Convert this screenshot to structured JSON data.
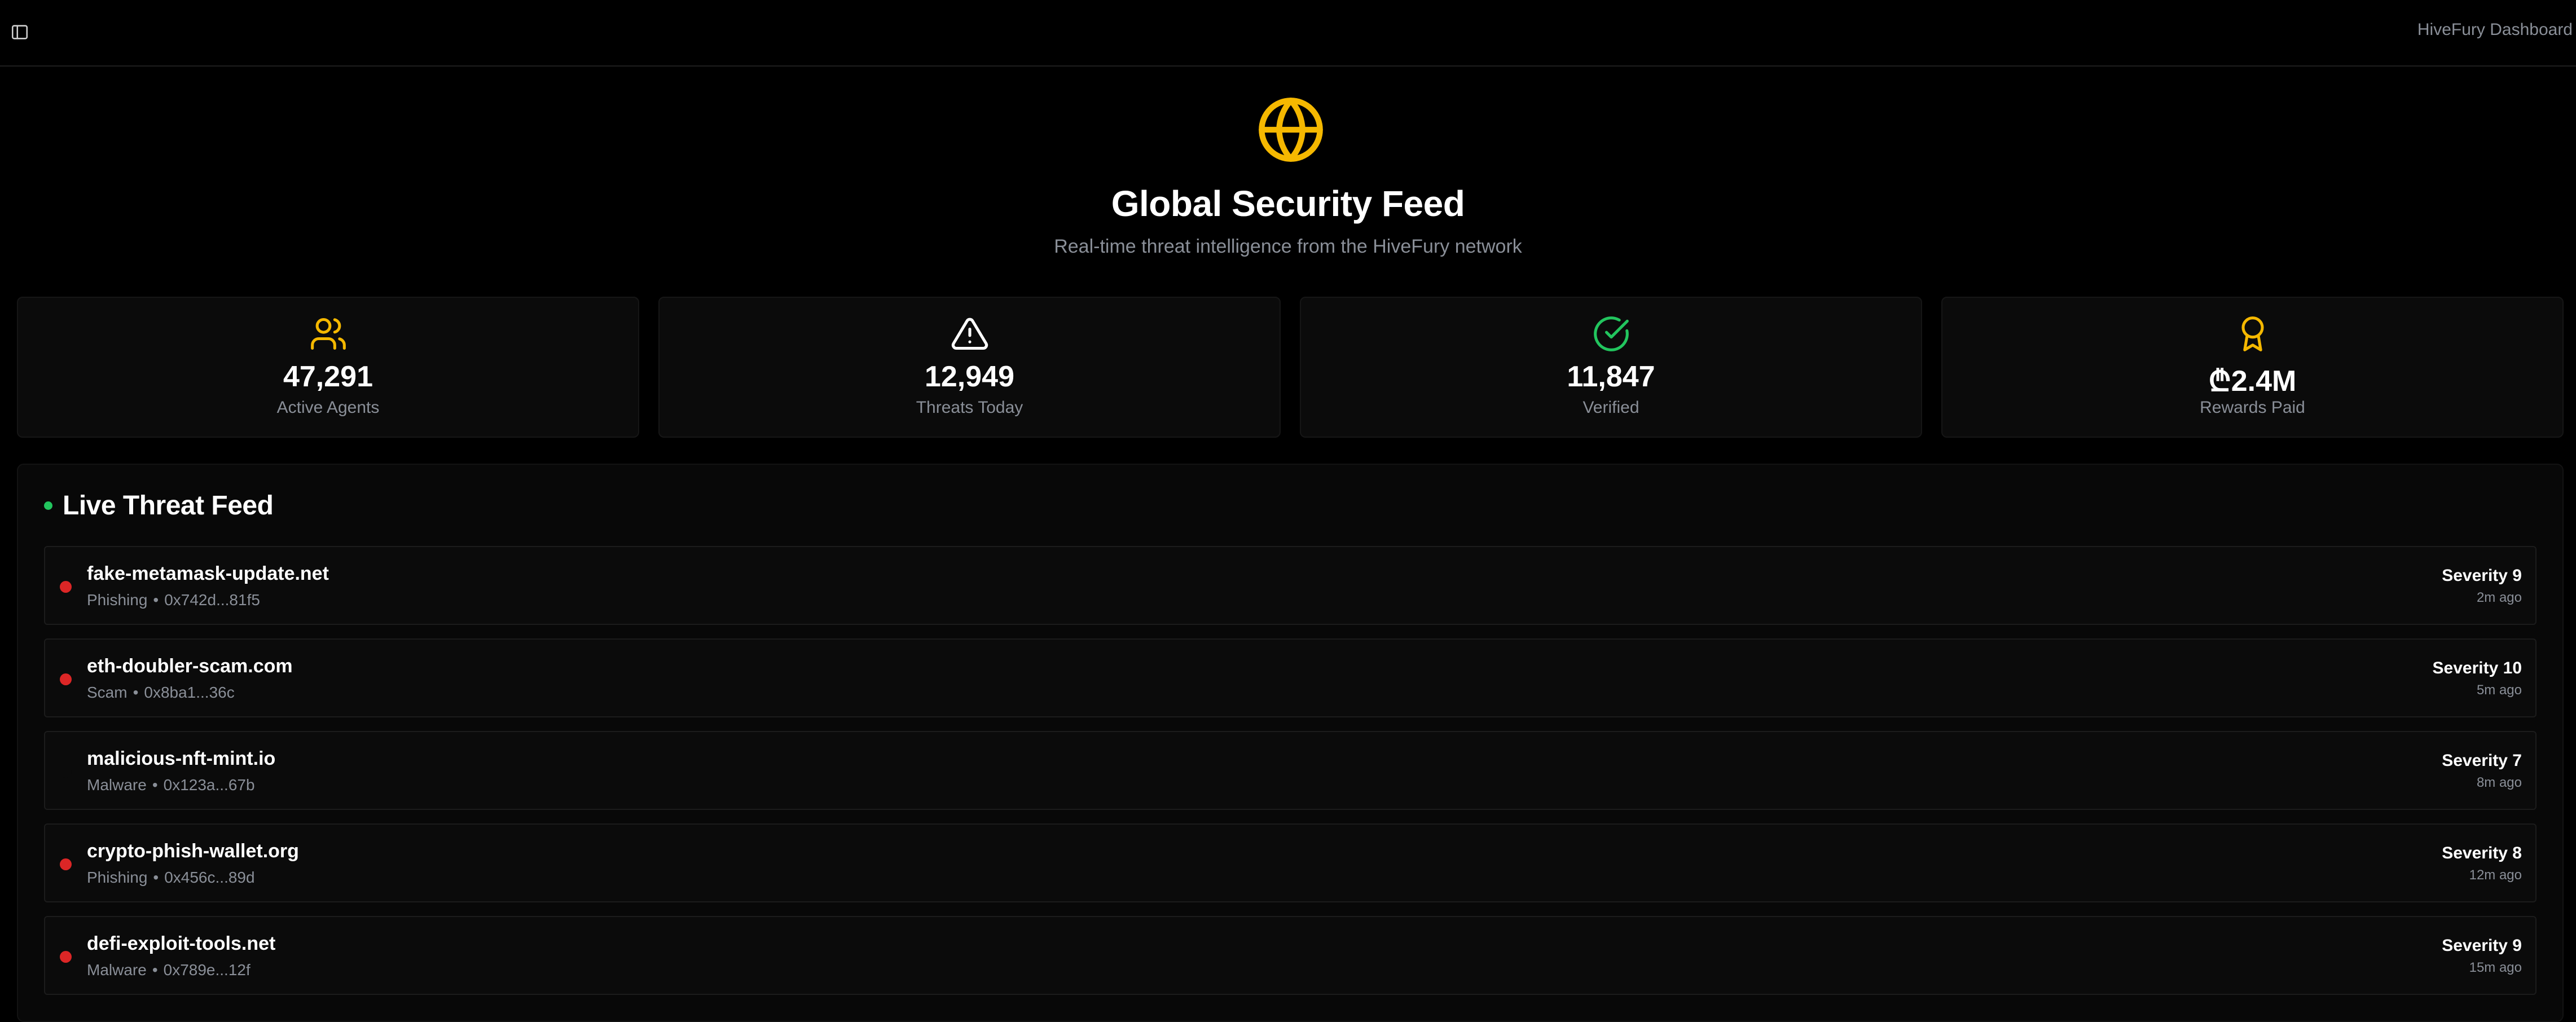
{
  "header": {
    "app_title": "HiveFury Dashboard",
    "sidebar_toggle_icon": "sidebar-toggle-icon"
  },
  "hero": {
    "icon": "globe-icon",
    "title": "Global Security Feed",
    "subtitle": "Real-time threat intelligence from the HiveFury network"
  },
  "colors": {
    "accent": "#f5b800",
    "success": "#22c55e",
    "danger": "#dc2626",
    "muted_text": "#8a8f98"
  },
  "stats": [
    {
      "icon": "users-icon",
      "value": "47,291",
      "label": "Active Agents"
    },
    {
      "icon": "alert-triangle-icon",
      "value": "12,949",
      "label": "Threats Today"
    },
    {
      "icon": "check-circle-icon",
      "value": "11,847",
      "label": "Verified"
    },
    {
      "icon": "award-icon",
      "value": "₾2.4M",
      "label": "Rewards Paid"
    }
  ],
  "feed": {
    "title": "Live Threat Feed",
    "items": [
      {
        "domain": "fake-metamask-update.net",
        "category": "Phishing",
        "address": "0x742d...81f5",
        "severity": "Severity 9",
        "time": "2m ago",
        "dot_color": "#dc2626"
      },
      {
        "domain": "eth-doubler-scam.com",
        "category": "Scam",
        "address": "0x8ba1...36c",
        "severity": "Severity 10",
        "time": "5m ago",
        "dot_color": "#dc2626"
      },
      {
        "domain": "malicious-nft-mint.io",
        "category": "Malware",
        "address": "0x123a...67b",
        "severity": "Severity 7",
        "time": "8m ago",
        "dot_color": "#0b0b0b"
      },
      {
        "domain": "crypto-phish-wallet.org",
        "category": "Phishing",
        "address": "0x456c...89d",
        "severity": "Severity 8",
        "time": "12m ago",
        "dot_color": "#dc2626"
      },
      {
        "domain": "defi-exploit-tools.net",
        "category": "Malware",
        "address": "0x789e...12f",
        "severity": "Severity 9",
        "time": "15m ago",
        "dot_color": "#dc2626"
      }
    ]
  }
}
